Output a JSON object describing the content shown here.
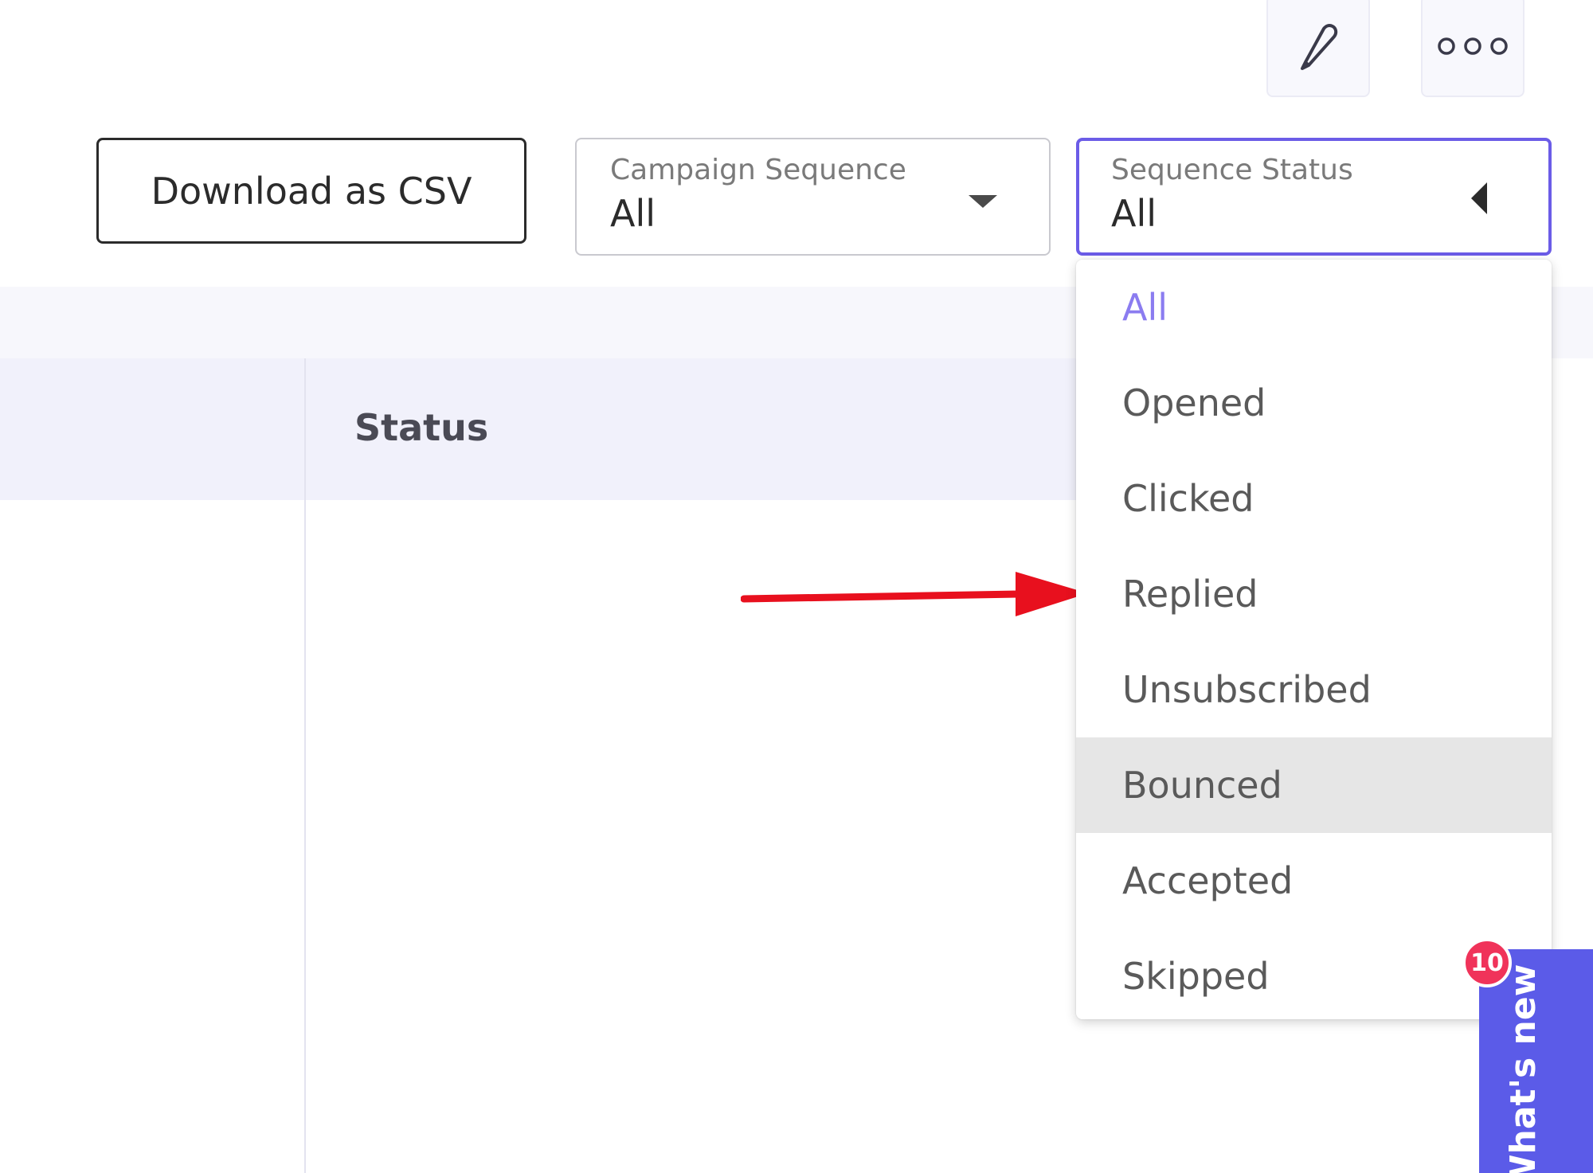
{
  "toolbar": {
    "edit_icon": "pencil-icon",
    "more_icon": "more-horizontal-icon",
    "download_label": "Download as CSV"
  },
  "filters": {
    "campaign_sequence": {
      "label": "Campaign Sequence",
      "value": "All",
      "icon": "caret-down-icon"
    },
    "sequence_status": {
      "label": "Sequence Status",
      "value": "All",
      "icon": "caret-left-icon",
      "accent_color": "#6b5ce7"
    }
  },
  "dropdown": {
    "selected_color": "#8b7cf0",
    "hover_index": 5,
    "options": [
      "All",
      "Opened",
      "Clicked",
      "Replied",
      "Unsubscribed",
      "Bounced",
      "Accepted",
      "Skipped"
    ]
  },
  "table": {
    "columns": [
      {
        "label": "Status"
      }
    ]
  },
  "annotation": {
    "arrow_color": "#e8101e",
    "points_to": "Replied"
  },
  "whats_new": {
    "label": "What's new",
    "badge_count": "10",
    "color": "#5b5be8",
    "badge_color": "#f0335a"
  }
}
